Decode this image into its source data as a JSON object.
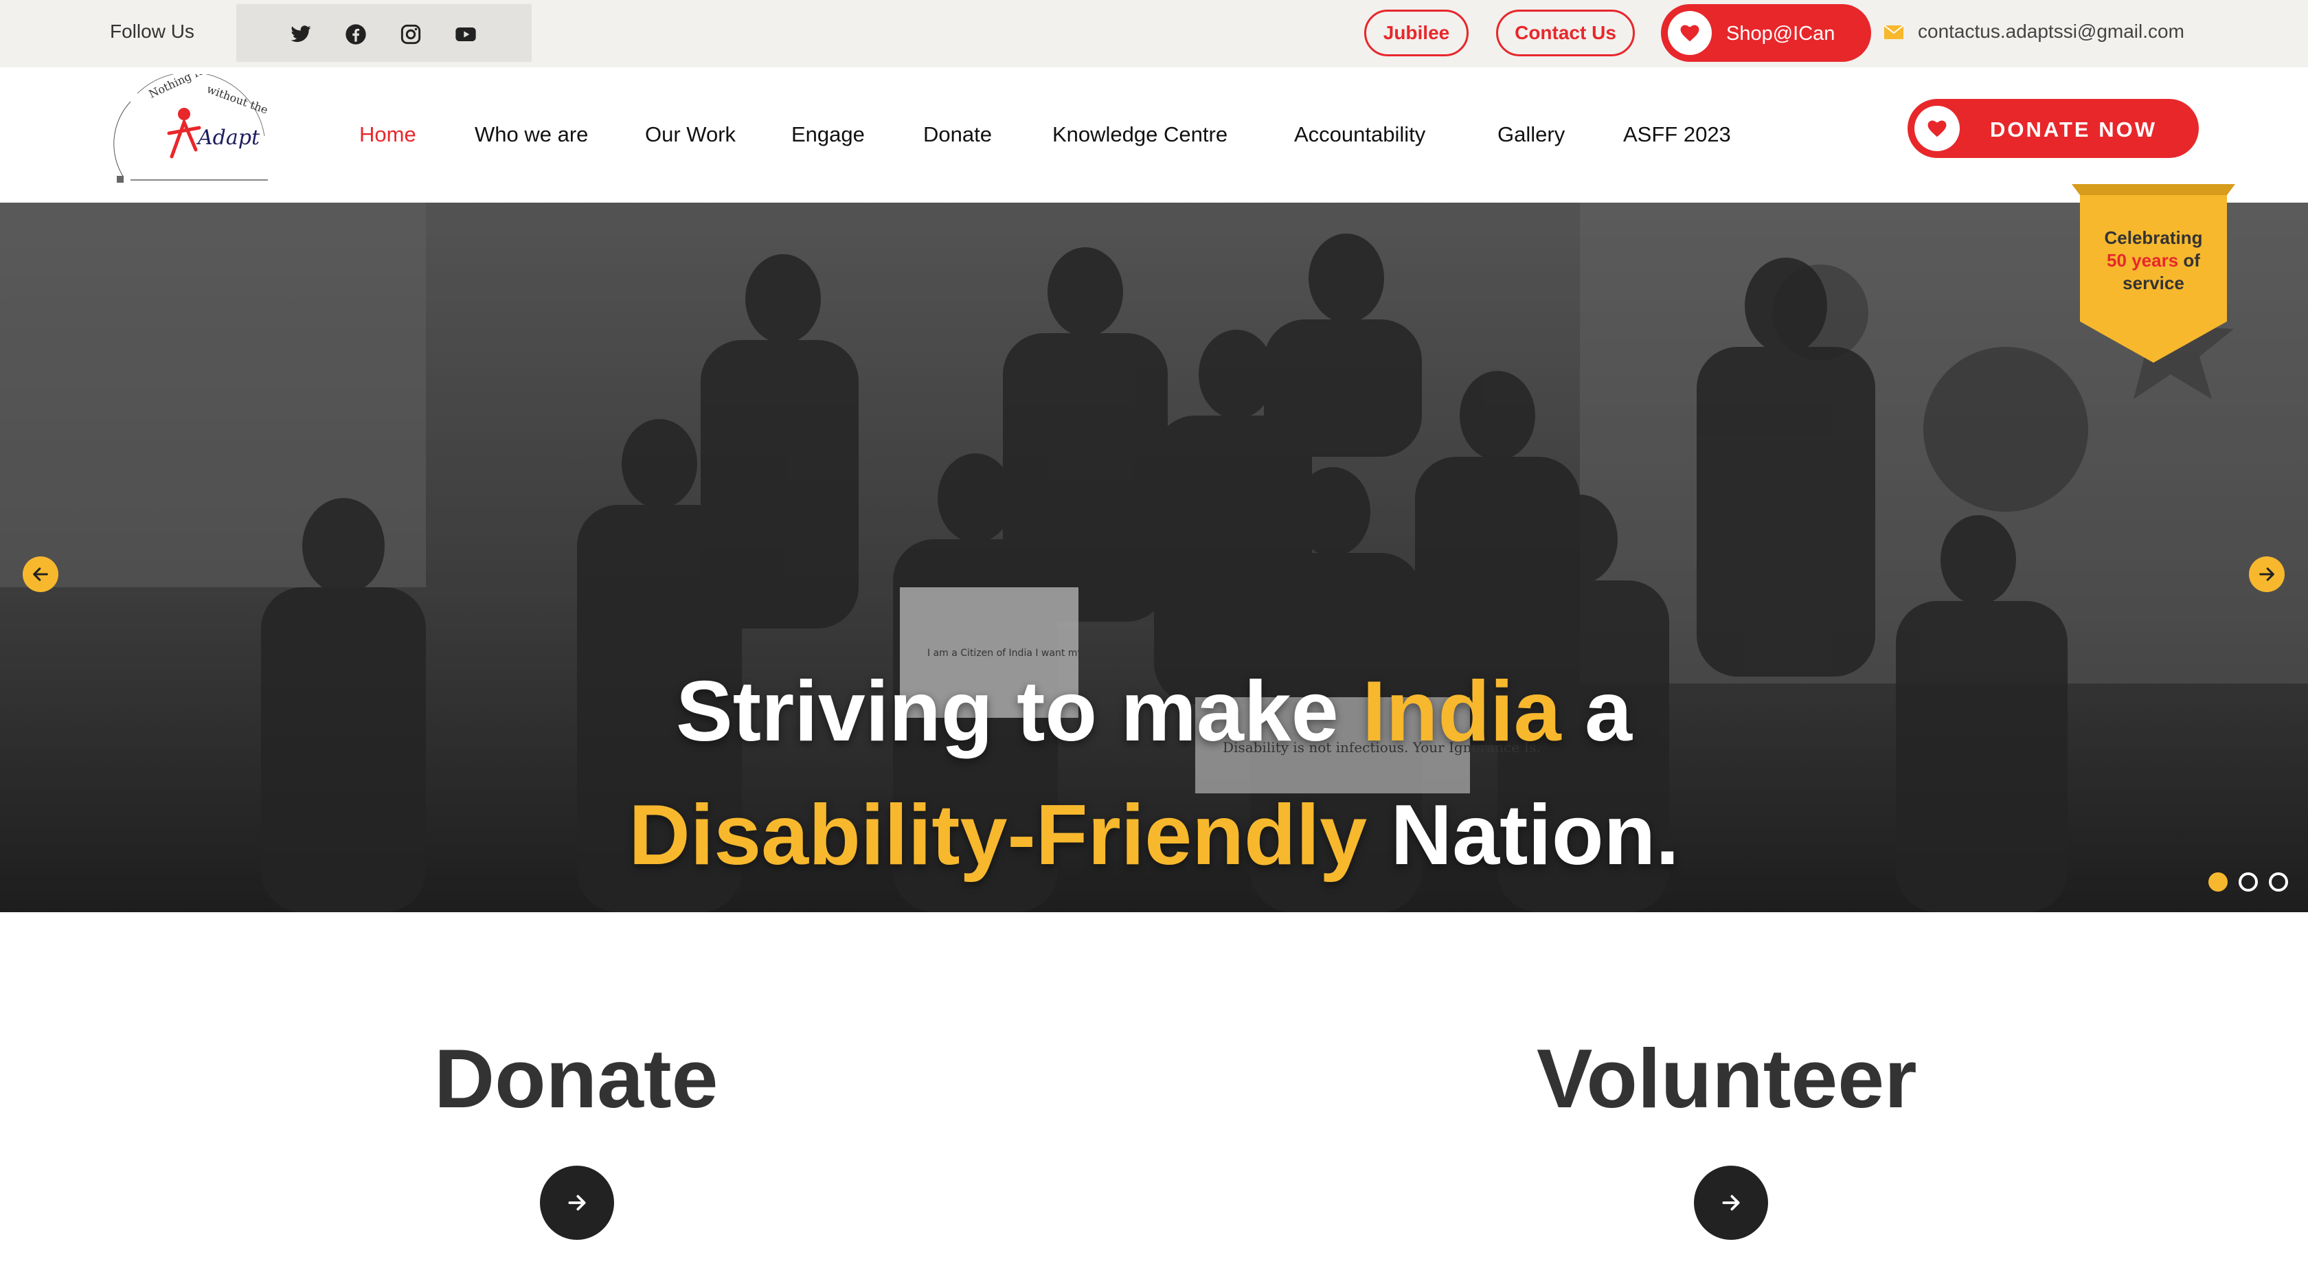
{
  "topbar": {
    "follow_label": "Follow Us",
    "socials": [
      "twitter-icon",
      "facebook-icon",
      "instagram-icon",
      "youtube-icon"
    ],
    "jubilee_label": "Jubilee",
    "contact_label": "Contact Us",
    "shop_label": "Shop@ICan",
    "email": "contactus.adaptssi@gmail.com"
  },
  "nav": {
    "logo_text": "Adapt",
    "logo_tagline": "Nothing for the disabled without the disabled",
    "items": [
      {
        "label": "Home",
        "active": true
      },
      {
        "label": "Who we are"
      },
      {
        "label": "Our Work"
      },
      {
        "label": "Engage"
      },
      {
        "label": "Donate"
      },
      {
        "label": "Knowledge Centre"
      },
      {
        "label": "Accountability"
      },
      {
        "label": "Gallery"
      },
      {
        "label": "ASFF 2023"
      }
    ],
    "donate_now_label": "DONATE NOW"
  },
  "hero": {
    "line1_part1": "Striving to make ",
    "line1_highlight": "India",
    "line1_part2": " a",
    "line2_highlight": "Disability-Friendly",
    "line2_part2": " Nation.",
    "slide_count": 3,
    "active_slide": 1,
    "badge_line1": "Celebrating",
    "badge_highlight": "50 years",
    "badge_of": "of",
    "badge_line3": "service",
    "placard_1": "I am a Citizen of India I want my civil rights",
    "placard_2": "Disability is not infectious. Your Ignorance Is."
  },
  "cta": {
    "donate_title": "Donate",
    "volunteer_title": "Volunteer"
  },
  "colors": {
    "brand_red": "#e8272b",
    "accent_yellow": "#f7b82e",
    "dark": "#222222"
  }
}
